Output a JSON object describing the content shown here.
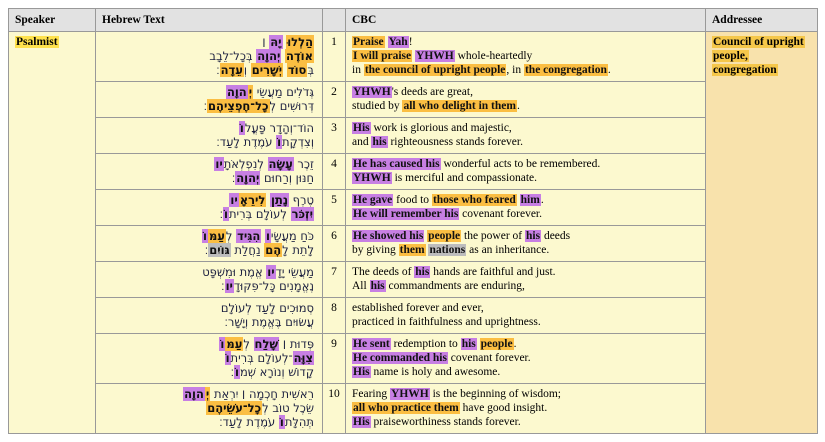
{
  "header": {
    "speaker": "Speaker",
    "hebrew": "Hebrew Text",
    "verse_num": "",
    "cbc": "CBC",
    "addressee": "Addressee"
  },
  "speaker": {
    "label": "Psalmist"
  },
  "addressee": {
    "label": "Council of upright people, congregation"
  },
  "colors": {
    "highlight_orange": "#FBBE42",
    "highlight_purple": "#C77FE3",
    "highlight_gray": "#BDBDBD",
    "highlight_yellow": "#FFE24D",
    "highlight_addressee": "#F5C74A",
    "row_bg": "#FCF9CF",
    "addressee_bg": "#F8E2AC",
    "header_bg": "#E2E2E2",
    "border": "#999999"
  },
  "verses": [
    {
      "num": "1",
      "hebrew": [
        [
          {
            "t": "הַלְלוּ",
            "h": "o"
          },
          {
            "t": " "
          },
          {
            "t": "יָהּ",
            "h": "p"
          },
          {
            "t": " ׀"
          }
        ],
        [
          {
            "t": "אוֹדֶה",
            "h": "o"
          },
          {
            "t": " "
          },
          {
            "t": "יְהוָה",
            "h": "p"
          },
          {
            "t": " בְּכָל־לֵבָב"
          }
        ],
        [
          {
            "t": "בְּ"
          },
          {
            "t": "סוֹד",
            "h": "o"
          },
          {
            "t": " "
          },
          {
            "t": "יְשָׁרִים",
            "h": "o"
          },
          {
            "t": " וְ"
          },
          {
            "t": "עֵדָה",
            "h": "o"
          },
          {
            "t": "׃"
          }
        ]
      ],
      "cbc": [
        [
          {
            "t": "Praise",
            "h": "o"
          },
          {
            "t": " "
          },
          {
            "t": "Yah",
            "h": "p"
          },
          {
            "t": "!"
          }
        ],
        [
          {
            "t": "I will praise",
            "h": "o"
          },
          {
            "t": " "
          },
          {
            "t": "YHWH",
            "h": "p"
          },
          {
            "t": " whole-heartedly"
          }
        ],
        [
          {
            "t": "in "
          },
          {
            "t": "the council of upright people",
            "h": "o"
          },
          {
            "t": ", in "
          },
          {
            "t": "the congregation",
            "h": "o"
          },
          {
            "t": "."
          }
        ]
      ]
    },
    {
      "num": "2",
      "hebrew": [
        [
          {
            "t": "גְּדֹלִים מַעֲשֵׂי "
          },
          {
            "t": "יְ",
            "h": "o"
          },
          {
            "t": "הוָה",
            "h": "p"
          }
        ],
        [
          {
            "t": "דְּרוּשִׁים לְ"
          },
          {
            "t": "כָל־חֶפְצֵיהֶם",
            "h": "o"
          },
          {
            "t": "׃"
          }
        ]
      ],
      "cbc": [
        [
          {
            "t": "YHWH",
            "h": "p"
          },
          {
            "t": "'s deeds are great,"
          }
        ],
        [
          {
            "t": "studied by "
          },
          {
            "t": "all who delight in them",
            "h": "o"
          },
          {
            "t": "."
          }
        ]
      ]
    },
    {
      "num": "3",
      "hebrew": [
        [
          {
            "t": "הוֹד־וְהָדָר פָּעֳל"
          },
          {
            "t": "וֹ",
            "h": "p"
          }
        ],
        [
          {
            "t": "וְצִדְקָת"
          },
          {
            "t": "וֹ",
            "h": "p"
          },
          {
            "t": " עֹמֶדֶת לָעַד׃"
          }
        ]
      ],
      "cbc": [
        [
          {
            "t": "His",
            "h": "p"
          },
          {
            "t": " work is glorious and majestic,"
          }
        ],
        [
          {
            "t": "and "
          },
          {
            "t": "his",
            "h": "p"
          },
          {
            "t": " righteousness stands forever."
          }
        ]
      ]
    },
    {
      "num": "4",
      "hebrew": [
        [
          {
            "t": "זֵכֶר "
          },
          {
            "t": "עָשָׂה",
            "h": "p"
          },
          {
            "t": " לְנִפְלְאֹתָ"
          },
          {
            "t": "יו",
            "h": "p"
          }
        ],
        [
          {
            "t": "חַנּוּן וְרַחוּם "
          },
          {
            "t": "יְהוָה",
            "h": "p"
          },
          {
            "t": "׃"
          }
        ]
      ],
      "cbc": [
        [
          {
            "t": "He has caused his",
            "h": "p"
          },
          {
            "t": " wonderful acts to be remembered."
          }
        ],
        [
          {
            "t": "YHWH",
            "h": "p"
          },
          {
            "t": " is merciful and compassionate."
          }
        ]
      ]
    },
    {
      "num": "5",
      "hebrew": [
        [
          {
            "t": "טֶרֶף "
          },
          {
            "t": "נָתַן",
            "h": "p"
          },
          {
            "t": " "
          },
          {
            "t": "לִירֵאָ",
            "h": "o"
          },
          {
            "t": "יו",
            "h": "p"
          }
        ],
        [
          {
            "t": "יִזְכֹּר",
            "h": "p"
          },
          {
            "t": " לְעוֹלָם בְּרִית"
          },
          {
            "t": "וֹ",
            "h": "p"
          },
          {
            "t": "׃"
          }
        ]
      ],
      "cbc": [
        [
          {
            "t": "He gave",
            "h": "p"
          },
          {
            "t": " food to "
          },
          {
            "t": "those who feared",
            "h": "o"
          },
          {
            "t": " "
          },
          {
            "t": "him",
            "h": "p"
          },
          {
            "t": "."
          }
        ],
        [
          {
            "t": "He will remember his",
            "h": "p"
          },
          {
            "t": " covenant forever."
          }
        ]
      ]
    },
    {
      "num": "6",
      "hebrew": [
        [
          {
            "t": "כֹּחַ מַעֲשָׂי"
          },
          {
            "t": "ו",
            "h": "p"
          },
          {
            "t": " "
          },
          {
            "t": "הִגִּיד",
            "h": "p"
          },
          {
            "t": " לְ"
          },
          {
            "t": "עַמּ",
            "h": "o"
          },
          {
            "t": "וֹ",
            "h": "p"
          }
        ],
        [
          {
            "t": "לָתֵת לָ"
          },
          {
            "t": "הֶם",
            "h": "o"
          },
          {
            "t": " נַחֲלַת "
          },
          {
            "t": "גּוֹיִם",
            "h": "g"
          },
          {
            "t": "׃"
          }
        ]
      ],
      "cbc": [
        [
          {
            "t": "He showed his",
            "h": "p"
          },
          {
            "t": " "
          },
          {
            "t": "people",
            "h": "o"
          },
          {
            "t": " the power of "
          },
          {
            "t": "his",
            "h": "p"
          },
          {
            "t": " deeds"
          }
        ],
        [
          {
            "t": "by giving "
          },
          {
            "t": "them",
            "h": "o"
          },
          {
            "t": " "
          },
          {
            "t": "nations",
            "h": "g"
          },
          {
            "t": " as an inheritance."
          }
        ]
      ]
    },
    {
      "num": "7",
      "hebrew": [
        [
          {
            "t": "מַעֲשֵׂי יָדָ"
          },
          {
            "t": "יו",
            "h": "p"
          },
          {
            "t": " אֱמֶת וּמִשְׁפָּט"
          }
        ],
        [
          {
            "t": "נֶאֱמָנִים כָּל־פִּקּוּדָ"
          },
          {
            "t": "יו",
            "h": "p"
          },
          {
            "t": "׃"
          }
        ]
      ],
      "cbc": [
        [
          {
            "t": "The deeds of "
          },
          {
            "t": "his",
            "h": "p"
          },
          {
            "t": " hands are faithful and just."
          }
        ],
        [
          {
            "t": "All "
          },
          {
            "t": "his",
            "h": "p"
          },
          {
            "t": " commandments are enduring,"
          }
        ]
      ]
    },
    {
      "num": "8",
      "hebrew": [
        [
          {
            "t": "סְמוּכִים לָעַד לְעוֹלָם"
          }
        ],
        [
          {
            "t": "עֲשׂוּיִם בֶּאֱמֶת וְיָשָׁר׃"
          }
        ]
      ],
      "cbc": [
        [
          {
            "t": "established forever and ever,"
          }
        ],
        [
          {
            "t": "practiced in faithfulness and uprightness."
          }
        ]
      ]
    },
    {
      "num": "9",
      "hebrew": [
        [
          {
            "t": "פְּדוּת ׀ "
          },
          {
            "t": "שָׁלַח",
            "h": "p"
          },
          {
            "t": " לְ"
          },
          {
            "t": "עַמּ",
            "h": "o"
          },
          {
            "t": "וֹ",
            "h": "p"
          }
        ],
        [
          {
            "t": "צִוָּה",
            "h": "p"
          },
          {
            "t": "־לְעוֹלָם בְּרִית"
          },
          {
            "t": "וֹ",
            "h": "p"
          }
        ],
        [
          {
            "t": "קָדוֹשׁ וְנוֹרָא שְׁמ"
          },
          {
            "t": "וֹ",
            "h": "p"
          },
          {
            "t": "׃"
          }
        ]
      ],
      "cbc": [
        [
          {
            "t": "He sent",
            "h": "p"
          },
          {
            "t": " redemption to "
          },
          {
            "t": "his",
            "h": "p"
          },
          {
            "t": " "
          },
          {
            "t": "people",
            "h": "o"
          },
          {
            "t": "."
          }
        ],
        [
          {
            "t": "He commanded his",
            "h": "p"
          },
          {
            "t": " covenant forever."
          }
        ],
        [
          {
            "t": "His",
            "h": "p"
          },
          {
            "t": " name is holy and awesome."
          }
        ]
      ]
    },
    {
      "num": "10",
      "hebrew": [
        [
          {
            "t": "רֵאשִׁית חָכְמָה ׀ יִרְאַת "
          },
          {
            "t": "יְ",
            "h": "o"
          },
          {
            "t": "הוָה",
            "h": "p"
          }
        ],
        [
          {
            "t": "שֵׂכֶל טוֹב לְ"
          },
          {
            "t": "כָל־עֹשֵׂיהֶם",
            "h": "o"
          }
        ],
        [
          {
            "t": "תְּהִלָּת"
          },
          {
            "t": "וֹ",
            "h": "p"
          },
          {
            "t": " עֹמֶדֶת לָעַד׃"
          }
        ]
      ],
      "cbc": [
        [
          {
            "t": "Fearing "
          },
          {
            "t": "YHWH",
            "h": "p"
          },
          {
            "t": " is the beginning of wisdom;"
          }
        ],
        [
          {
            "t": "all who practice them",
            "h": "o"
          },
          {
            "t": " have good insight."
          }
        ],
        [
          {
            "t": "His",
            "h": "p"
          },
          {
            "t": " praiseworthiness stands forever."
          }
        ]
      ]
    }
  ]
}
